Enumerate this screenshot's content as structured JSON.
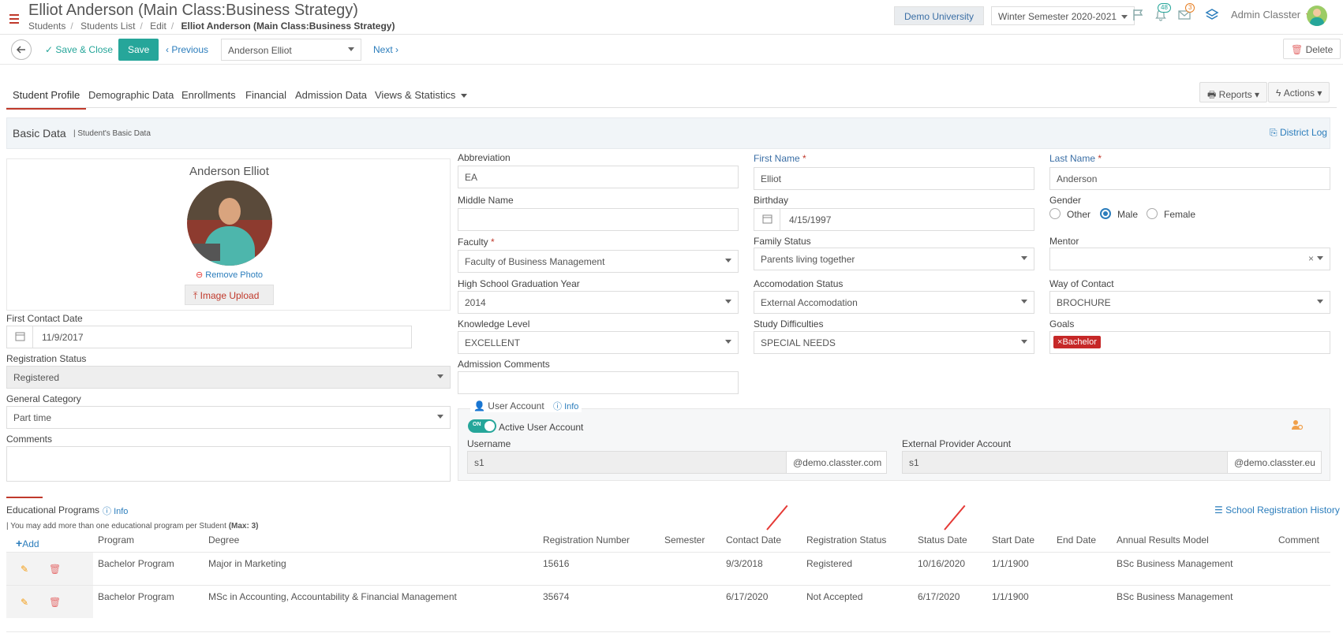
{
  "header": {
    "title": "Elliot Anderson (Main Class:Business Strategy)",
    "breadcrumbs": [
      "Students",
      "Students List",
      "Edit",
      "Elliot Anderson (Main Class:Business Strategy)"
    ],
    "university": "Demo University",
    "semester": "Winter Semester 2020-2021",
    "notifications_count": "48",
    "messages_count": "3",
    "user": "Admin Classter"
  },
  "toolbar": {
    "save_close": "Save & Close",
    "save": "Save",
    "previous": "Previous",
    "student_select": "Anderson Elliot",
    "next": "Next",
    "delete": "Delete"
  },
  "tabs": [
    "Student Profile",
    "Demographic Data",
    "Enrollments",
    "Financial",
    "Admission Data",
    "Views & Statistics"
  ],
  "tab_actions": {
    "reports": "Reports",
    "actions": "Actions"
  },
  "section": {
    "title": "Basic Data",
    "subtitle": "| Student's Basic Data",
    "district_log": "District Log"
  },
  "profile": {
    "name": "Anderson Elliot",
    "remove_photo": "Remove Photo",
    "image_upload": "Image Upload"
  },
  "left_fields": {
    "first_contact_label": "First Contact Date",
    "first_contact": "11/9/2017",
    "reg_status_label": "Registration Status",
    "reg_status": "Registered",
    "general_cat_label": "General Category",
    "general_cat": "Part time",
    "comments_label": "Comments"
  },
  "form": {
    "abbreviation_label": "Abbreviation",
    "abbreviation": "EA",
    "middle_label": "Middle Name",
    "faculty_label": "Faculty",
    "faculty": "Faculty of Business Management",
    "hs_label": "High School Graduation Year",
    "hs": "2014",
    "knowledge_label": "Knowledge Level",
    "knowledge": "EXCELLENT",
    "admission_label": "Admission Comments",
    "first_label": "First Name",
    "first": "Elliot",
    "birthday_label": "Birthday",
    "birthday": "4/15/1997",
    "family_label": "Family Status",
    "family": "Parents living together",
    "accom_label": "Accomodation Status",
    "accom": "External Accomodation",
    "difficulties_label": "Study Difficulties",
    "difficulties": "SPECIAL NEEDS",
    "last_label": "Last Name",
    "last": "Anderson",
    "gender_label": "Gender",
    "gender_options": [
      "Other",
      "Male",
      "Female"
    ],
    "mentor_label": "Mentor",
    "contact_label": "Way of Contact",
    "contact": "BROCHURE",
    "goals_label": "Goals",
    "goal_tag": "Bachelor"
  },
  "user_account": {
    "title": "User Account",
    "info": "Info",
    "toggle": "ON",
    "active_label": "Active User Account",
    "username_label": "Username",
    "username": "s1",
    "username_domain": "@demo.classter.com",
    "external_label": "External Provider Account",
    "external": "s1",
    "external_domain": "@demo.classter.eu"
  },
  "programs": {
    "title": "Educational Programs",
    "info": "Info",
    "note": "| You may add more than one educational program per Student",
    "max": "(Max: 3)",
    "add": "Add",
    "history": "School Registration History",
    "columns": [
      "Program",
      "Degree",
      "Registration Number",
      "Semester",
      "Contact Date",
      "Registration Status",
      "Status Date",
      "Start Date",
      "End Date",
      "Annual Results Model",
      "Comment"
    ],
    "rows": [
      [
        "Bachelor Program",
        "Major in Marketing",
        "15616",
        "",
        "9/3/2018",
        "Registered",
        "10/16/2020",
        "1/1/1900",
        "",
        "BSc Business Management",
        ""
      ],
      [
        "Bachelor Program",
        "MSc in Accounting, Accountability & Financial Management",
        "35674",
        "",
        "6/17/2020",
        "Not Accepted",
        "6/17/2020",
        "1/1/1900",
        "",
        "BSc Business Management",
        ""
      ]
    ]
  }
}
